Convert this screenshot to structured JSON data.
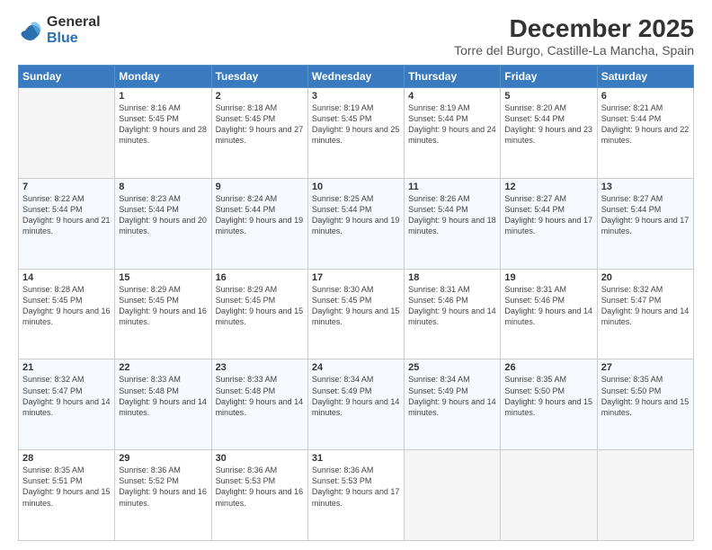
{
  "logo": {
    "general": "General",
    "blue": "Blue"
  },
  "title": "December 2025",
  "subtitle": "Torre del Burgo, Castille-La Mancha, Spain",
  "days_of_week": [
    "Sunday",
    "Monday",
    "Tuesday",
    "Wednesday",
    "Thursday",
    "Friday",
    "Saturday"
  ],
  "weeks": [
    [
      {
        "day": "",
        "info": ""
      },
      {
        "day": "1",
        "sunrise": "Sunrise: 8:16 AM",
        "sunset": "Sunset: 5:45 PM",
        "daylight": "Daylight: 9 hours and 28 minutes."
      },
      {
        "day": "2",
        "sunrise": "Sunrise: 8:18 AM",
        "sunset": "Sunset: 5:45 PM",
        "daylight": "Daylight: 9 hours and 27 minutes."
      },
      {
        "day": "3",
        "sunrise": "Sunrise: 8:19 AM",
        "sunset": "Sunset: 5:45 PM",
        "daylight": "Daylight: 9 hours and 25 minutes."
      },
      {
        "day": "4",
        "sunrise": "Sunrise: 8:19 AM",
        "sunset": "Sunset: 5:44 PM",
        "daylight": "Daylight: 9 hours and 24 minutes."
      },
      {
        "day": "5",
        "sunrise": "Sunrise: 8:20 AM",
        "sunset": "Sunset: 5:44 PM",
        "daylight": "Daylight: 9 hours and 23 minutes."
      },
      {
        "day": "6",
        "sunrise": "Sunrise: 8:21 AM",
        "sunset": "Sunset: 5:44 PM",
        "daylight": "Daylight: 9 hours and 22 minutes."
      }
    ],
    [
      {
        "day": "7",
        "sunrise": "Sunrise: 8:22 AM",
        "sunset": "Sunset: 5:44 PM",
        "daylight": "Daylight: 9 hours and 21 minutes."
      },
      {
        "day": "8",
        "sunrise": "Sunrise: 8:23 AM",
        "sunset": "Sunset: 5:44 PM",
        "daylight": "Daylight: 9 hours and 20 minutes."
      },
      {
        "day": "9",
        "sunrise": "Sunrise: 8:24 AM",
        "sunset": "Sunset: 5:44 PM",
        "daylight": "Daylight: 9 hours and 19 minutes."
      },
      {
        "day": "10",
        "sunrise": "Sunrise: 8:25 AM",
        "sunset": "Sunset: 5:44 PM",
        "daylight": "Daylight: 9 hours and 19 minutes."
      },
      {
        "day": "11",
        "sunrise": "Sunrise: 8:26 AM",
        "sunset": "Sunset: 5:44 PM",
        "daylight": "Daylight: 9 hours and 18 minutes."
      },
      {
        "day": "12",
        "sunrise": "Sunrise: 8:27 AM",
        "sunset": "Sunset: 5:44 PM",
        "daylight": "Daylight: 9 hours and 17 minutes."
      },
      {
        "day": "13",
        "sunrise": "Sunrise: 8:27 AM",
        "sunset": "Sunset: 5:44 PM",
        "daylight": "Daylight: 9 hours and 17 minutes."
      }
    ],
    [
      {
        "day": "14",
        "sunrise": "Sunrise: 8:28 AM",
        "sunset": "Sunset: 5:45 PM",
        "daylight": "Daylight: 9 hours and 16 minutes."
      },
      {
        "day": "15",
        "sunrise": "Sunrise: 8:29 AM",
        "sunset": "Sunset: 5:45 PM",
        "daylight": "Daylight: 9 hours and 16 minutes."
      },
      {
        "day": "16",
        "sunrise": "Sunrise: 8:29 AM",
        "sunset": "Sunset: 5:45 PM",
        "daylight": "Daylight: 9 hours and 15 minutes."
      },
      {
        "day": "17",
        "sunrise": "Sunrise: 8:30 AM",
        "sunset": "Sunset: 5:45 PM",
        "daylight": "Daylight: 9 hours and 15 minutes."
      },
      {
        "day": "18",
        "sunrise": "Sunrise: 8:31 AM",
        "sunset": "Sunset: 5:46 PM",
        "daylight": "Daylight: 9 hours and 14 minutes."
      },
      {
        "day": "19",
        "sunrise": "Sunrise: 8:31 AM",
        "sunset": "Sunset: 5:46 PM",
        "daylight": "Daylight: 9 hours and 14 minutes."
      },
      {
        "day": "20",
        "sunrise": "Sunrise: 8:32 AM",
        "sunset": "Sunset: 5:47 PM",
        "daylight": "Daylight: 9 hours and 14 minutes."
      }
    ],
    [
      {
        "day": "21",
        "sunrise": "Sunrise: 8:32 AM",
        "sunset": "Sunset: 5:47 PM",
        "daylight": "Daylight: 9 hours and 14 minutes."
      },
      {
        "day": "22",
        "sunrise": "Sunrise: 8:33 AM",
        "sunset": "Sunset: 5:48 PM",
        "daylight": "Daylight: 9 hours and 14 minutes."
      },
      {
        "day": "23",
        "sunrise": "Sunrise: 8:33 AM",
        "sunset": "Sunset: 5:48 PM",
        "daylight": "Daylight: 9 hours and 14 minutes."
      },
      {
        "day": "24",
        "sunrise": "Sunrise: 8:34 AM",
        "sunset": "Sunset: 5:49 PM",
        "daylight": "Daylight: 9 hours and 14 minutes."
      },
      {
        "day": "25",
        "sunrise": "Sunrise: 8:34 AM",
        "sunset": "Sunset: 5:49 PM",
        "daylight": "Daylight: 9 hours and 14 minutes."
      },
      {
        "day": "26",
        "sunrise": "Sunrise: 8:35 AM",
        "sunset": "Sunset: 5:50 PM",
        "daylight": "Daylight: 9 hours and 15 minutes."
      },
      {
        "day": "27",
        "sunrise": "Sunrise: 8:35 AM",
        "sunset": "Sunset: 5:50 PM",
        "daylight": "Daylight: 9 hours and 15 minutes."
      }
    ],
    [
      {
        "day": "28",
        "sunrise": "Sunrise: 8:35 AM",
        "sunset": "Sunset: 5:51 PM",
        "daylight": "Daylight: 9 hours and 15 minutes."
      },
      {
        "day": "29",
        "sunrise": "Sunrise: 8:36 AM",
        "sunset": "Sunset: 5:52 PM",
        "daylight": "Daylight: 9 hours and 16 minutes."
      },
      {
        "day": "30",
        "sunrise": "Sunrise: 8:36 AM",
        "sunset": "Sunset: 5:53 PM",
        "daylight": "Daylight: 9 hours and 16 minutes."
      },
      {
        "day": "31",
        "sunrise": "Sunrise: 8:36 AM",
        "sunset": "Sunset: 5:53 PM",
        "daylight": "Daylight: 9 hours and 17 minutes."
      },
      {
        "day": "",
        "info": ""
      },
      {
        "day": "",
        "info": ""
      },
      {
        "day": "",
        "info": ""
      }
    ]
  ]
}
